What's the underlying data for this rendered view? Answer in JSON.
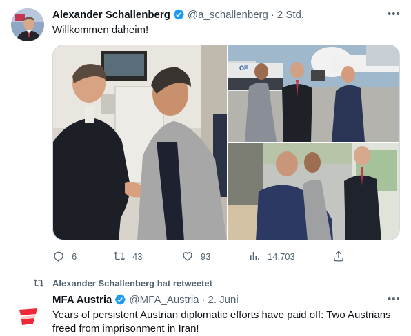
{
  "tweet": {
    "author_name": "Alexander Schallenberg",
    "handle": "@a_schallenberg",
    "separator": "·",
    "time": "2 Std.",
    "text": "Willkommen daheim!",
    "more": "•••",
    "actions": {
      "replies": "6",
      "retweets": "43",
      "likes": "93",
      "views": "14.703"
    }
  },
  "retweet": {
    "notice": "Alexander Schallenberg hat retweetet",
    "author_name": "MFA Austria",
    "handle": "@MFA_Austria",
    "separator": "·",
    "time": "2. Juni",
    "more": "•••",
    "text": "Years of persistent Austrian diplomatic efforts have paid off: Two Austrians freed from imprisonment in Iran!"
  },
  "plane_lettering": "OE",
  "colors": {
    "verified_blue": "#1d9bf0",
    "secondary_text": "#536471",
    "austria_red": "#ed2939"
  },
  "icons": [
    "reply-icon",
    "retweet-icon",
    "like-icon",
    "views-icon",
    "share-icon",
    "verified-icon",
    "more-icon"
  ]
}
